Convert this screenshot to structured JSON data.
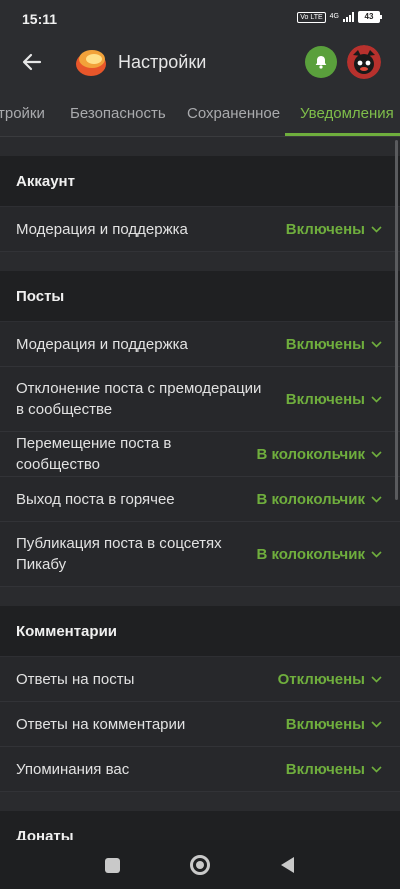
{
  "status_bar": {
    "time": "15:11",
    "vo_label": "Vo LTE",
    "network": "4G",
    "battery": "43"
  },
  "header": {
    "title": "Настройки"
  },
  "tabs": [
    {
      "label": "Настройки",
      "shown_text": "тройки",
      "active": false
    },
    {
      "label": "Безопасность",
      "shown_text": "Безопасность",
      "active": false
    },
    {
      "label": "Сохраненное",
      "shown_text": "Сохраненное",
      "active": false
    },
    {
      "label": "Уведомления",
      "shown_text": "Уведомления",
      "active": true
    }
  ],
  "sections": [
    {
      "title": "Аккаунт",
      "rows": [
        {
          "label": "Модерация и поддержка",
          "value": "Включены"
        }
      ]
    },
    {
      "title": "Посты",
      "rows": [
        {
          "label": "Модерация и поддержка",
          "value": "Включены"
        },
        {
          "label": "Отклонение поста с премодерации в сообществе",
          "value": "Включены"
        },
        {
          "label": "Перемещение поста в сообщество",
          "value": "В колокольчик"
        },
        {
          "label": "Выход поста в горячее",
          "value": "В колокольчик"
        },
        {
          "label": "Публикация поста в соцсетях Пикабу",
          "value": "В колокольчик"
        }
      ]
    },
    {
      "title": "Комментарии",
      "rows": [
        {
          "label": "Ответы на посты",
          "value": "Отключены"
        },
        {
          "label": "Ответы на комментарии",
          "value": "Включены"
        },
        {
          "label": "Упоминания вас",
          "value": "Включены"
        }
      ]
    },
    {
      "title": "Донаты",
      "rows": []
    }
  ],
  "colors": {
    "accent": "#6fae3d",
    "bell_button": "#5aa03c",
    "section_header_bg": "#1f2022",
    "row_bg": "#27282b"
  },
  "icons": {
    "back": "arrow-left-icon",
    "logo": "pikabu-logo-icon",
    "bell": "bell-icon",
    "chevron": "chevron-down-icon"
  }
}
